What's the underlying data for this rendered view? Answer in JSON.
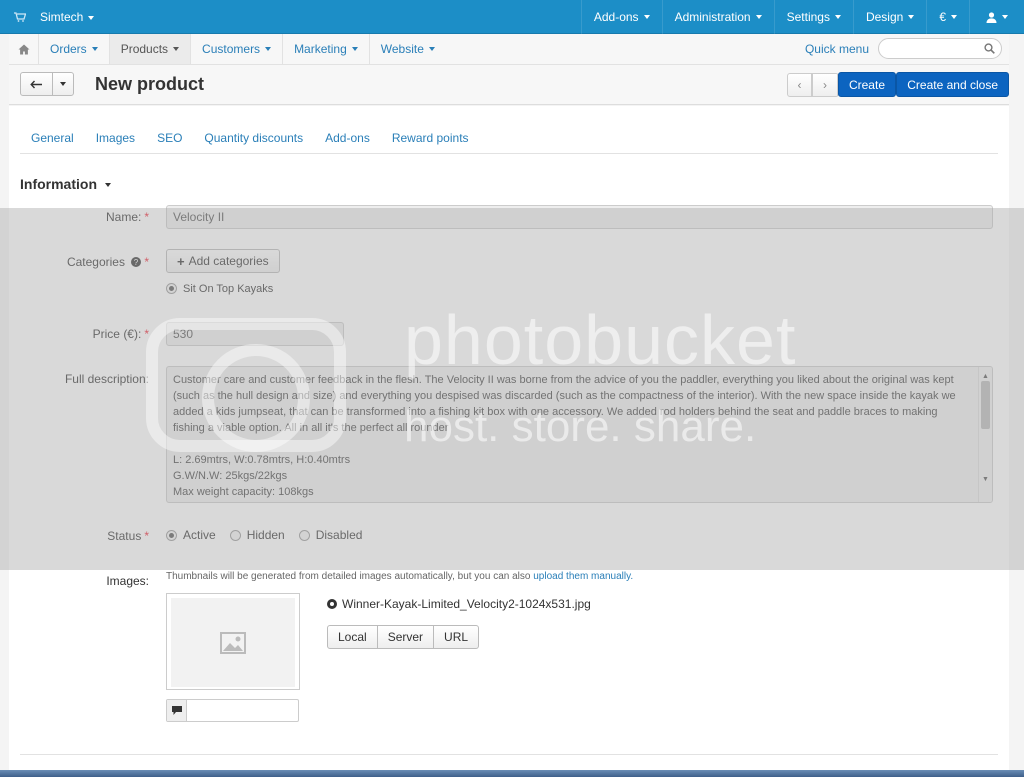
{
  "topbar": {
    "brand": "Simtech",
    "menu": [
      "Add-ons",
      "Administration",
      "Settings",
      "Design",
      "€",
      ""
    ]
  },
  "nav": {
    "items": [
      "Orders",
      "Products",
      "Customers",
      "Marketing",
      "Website"
    ],
    "active": "Products",
    "quick_menu": "Quick menu",
    "search_placeholder": ""
  },
  "header": {
    "title": "New product",
    "create": "Create",
    "create_close": "Create and close"
  },
  "tabs": [
    "General",
    "Images",
    "SEO",
    "Quantity discounts",
    "Add-ons",
    "Reward points"
  ],
  "section": {
    "title": "Information"
  },
  "form": {
    "name_label": "Name:",
    "name_value": "Velocity II",
    "categories_label": "Categories",
    "add_categories": "Add categories",
    "category": "Sit On Top Kayaks",
    "price_label": "Price (€):",
    "price_value": "530",
    "description_label": "Full description:",
    "description_p1": "Customer care and customer feedback in the flesh. The Velocity II was borne from the advice of you the paddler, everything you liked about the original was kept (such as the hull design and size) and everything you despised was discarded (such as the compactness of the interior). With the new space inside the kayak we added a kids jumpseat, that can be transformed into a fishing kit box with one accessory. We added rod holders behind the seat and paddle braces to making fishing a viable option. All in all it's the perfect all rounder",
    "description_l2": "L: 2.69mtrs, W:0.78mtrs, H:0.40mtrs",
    "description_l3": "G.W/N.W: 25kgs/22kgs",
    "description_l4": "Max weight capacity: 108kgs",
    "status_label": "Status",
    "status_options": [
      "Active",
      "Hidden",
      "Disabled"
    ],
    "status_selected": "Active",
    "images_label": "Images:",
    "images_help": "Thumbnails will be generated from detailed images automatically, but you can also",
    "images_help_link": "upload them manually.",
    "file_name": "Winner-Kayak-Limited_Velocity2-1024x531.jpg",
    "upload_buttons": [
      "Local",
      "Server",
      "URL"
    ]
  },
  "watermark": {
    "line1": "photobucket",
    "line2": "host. store. share."
  },
  "colors": {
    "topbar": "#1c8ec7",
    "primary": "#0c64c0",
    "link": "#2a7fb8"
  }
}
